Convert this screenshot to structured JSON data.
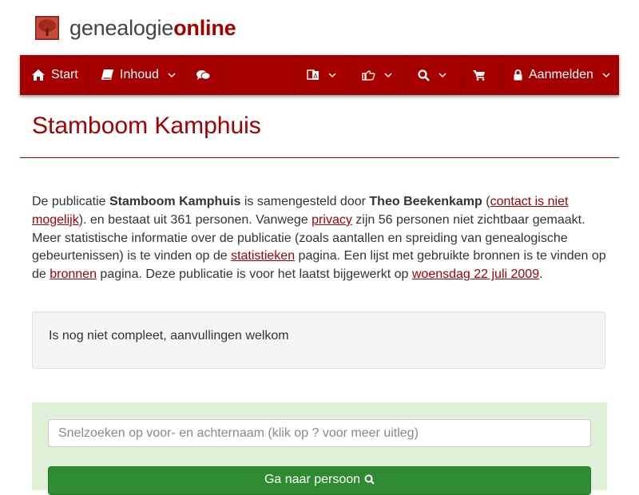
{
  "brand": {
    "name_plain": "genealogie",
    "name_bold": "online",
    "logo_icon": "tree-icon"
  },
  "nav": {
    "start_label": "Start",
    "inhoud_label": "Inhoud",
    "login_label": "Aanmelden",
    "icons": [
      "home-icon",
      "book-icon",
      "chat-icon",
      "language-icon",
      "share-icon",
      "search-icon",
      "cart-icon",
      "lock-icon"
    ]
  },
  "page": {
    "title": "Stamboom Kamphuis",
    "intro": {
      "t1": "De publicatie ",
      "pub_name": "Stamboom Kamphuis",
      "t2": " is samengesteld door ",
      "author": "Theo Beekenkamp",
      "t3": " (",
      "contact_link": "contact is niet mogelijk",
      "t4": "). en bestaat uit 361 personen. Vanwege ",
      "privacy_link": "privacy",
      "t5": " zijn 56 personen niet zichtbaar gemaakt. Meer statistische informatie over de publicatie (zoals aantallen en spreiding van genealogische gebeurtenissen) is te vinden op de ",
      "stats_link": "statistieken",
      "t6": " pagina. Een lijst met gebruikte bronnen is te vinden op de ",
      "sources_link": "bronnen",
      "t7": " pagina. Deze publicatie is voor het laatst bijgewerkt op ",
      "date_link": "woensdag 22 juli 2009",
      "t8": "."
    },
    "note": "Is nog niet compleet, aanvullingen welkom"
  },
  "search": {
    "placeholder": "Snelzoeken op voor- en achternaam (klik op ? voor meer uitleg)",
    "button_label": "Ga naar persoon"
  },
  "colors": {
    "brand": "#a50000",
    "search_bg": "#dff0d8",
    "button": "#2e8b32"
  }
}
